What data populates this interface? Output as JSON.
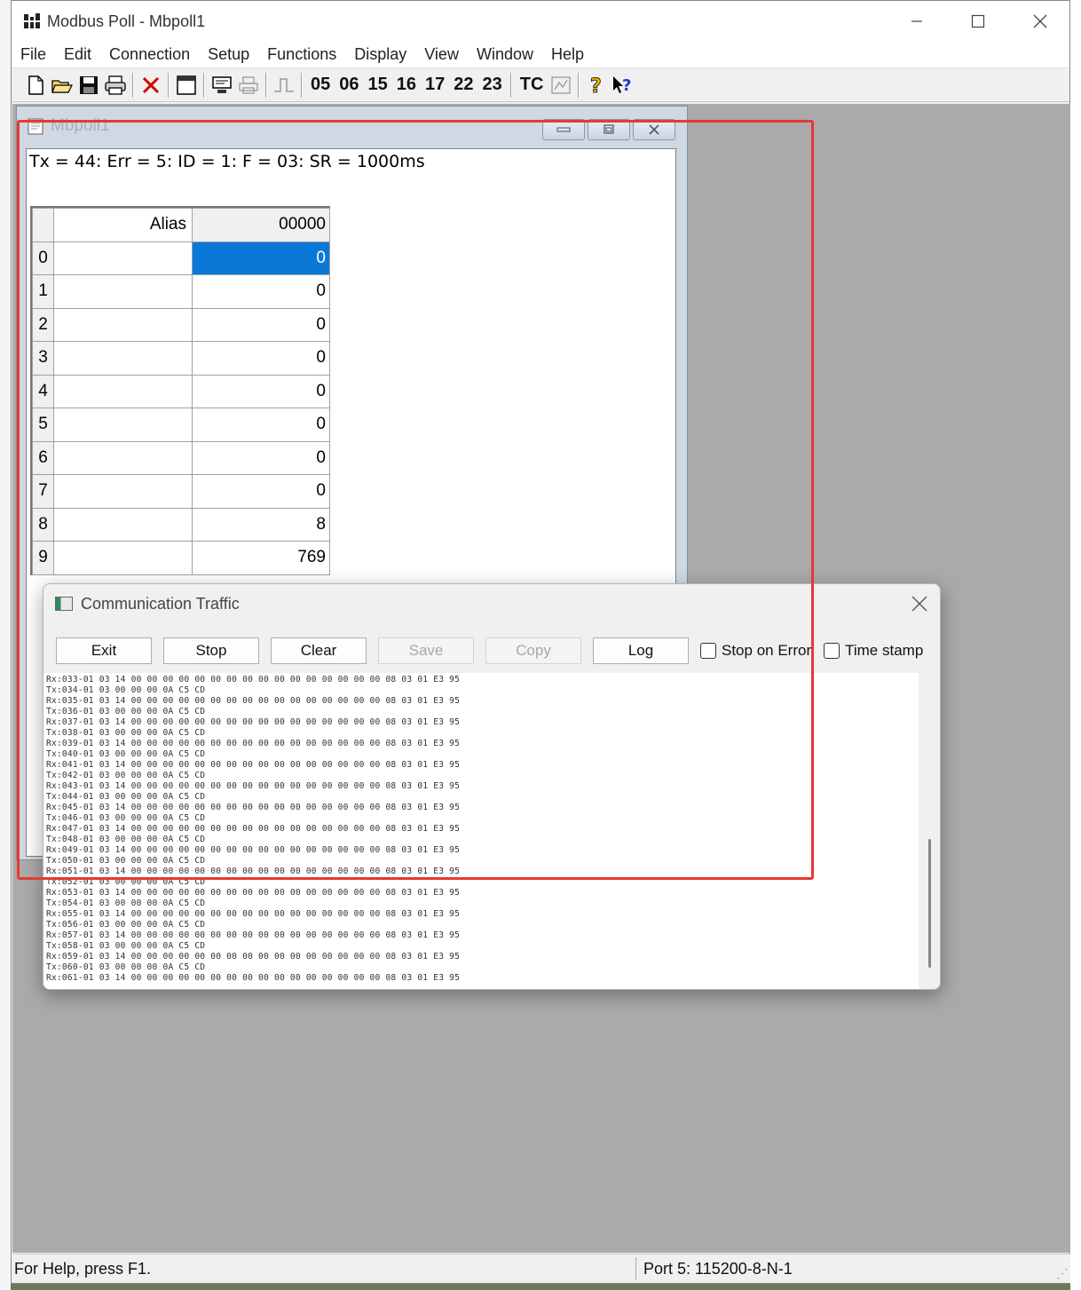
{
  "window": {
    "title": "Modbus Poll - Mbpoll1"
  },
  "menu": [
    "File",
    "Edit",
    "Connection",
    "Setup",
    "Functions",
    "Display",
    "View",
    "Window",
    "Help"
  ],
  "toolbar": {
    "function_codes": [
      "05",
      "06",
      "15",
      "16",
      "17",
      "22",
      "23"
    ],
    "tc_label": "TC"
  },
  "child": {
    "title": "Mbpoll1",
    "status": "Tx = 44: Err = 5: ID = 1: F = 03: SR = 1000ms",
    "columns": {
      "alias": "Alias",
      "address": "00000"
    },
    "rows": [
      {
        "index": "0",
        "alias": "",
        "value": "0"
      },
      {
        "index": "1",
        "alias": "",
        "value": "0"
      },
      {
        "index": "2",
        "alias": "",
        "value": "0"
      },
      {
        "index": "3",
        "alias": "",
        "value": "0"
      },
      {
        "index": "4",
        "alias": "",
        "value": "0"
      },
      {
        "index": "5",
        "alias": "",
        "value": "0"
      },
      {
        "index": "6",
        "alias": "",
        "value": "0"
      },
      {
        "index": "7",
        "alias": "",
        "value": "0"
      },
      {
        "index": "8",
        "alias": "",
        "value": "8"
      },
      {
        "index": "9",
        "alias": "",
        "value": "769"
      }
    ]
  },
  "traffic": {
    "title": "Communication Traffic",
    "buttons": {
      "exit": "Exit",
      "stop": "Stop",
      "clear": "Clear",
      "save": "Save",
      "copy": "Copy",
      "log": "Log"
    },
    "checkboxes": {
      "stop_on_error": "Stop on Error",
      "time_stamp": "Time stamp"
    },
    "lines": [
      "Rx:033-01 03 14 00 00 00 00 00 00 00 00 00 00 00 00 00 00 00 00 08 03 01 E3 95",
      "Tx:034-01 03 00 00 00 0A C5 CD",
      "Rx:035-01 03 14 00 00 00 00 00 00 00 00 00 00 00 00 00 00 00 00 08 03 01 E3 95",
      "Tx:036-01 03 00 00 00 0A C5 CD",
      "Rx:037-01 03 14 00 00 00 00 00 00 00 00 00 00 00 00 00 00 00 00 08 03 01 E3 95",
      "Tx:038-01 03 00 00 00 0A C5 CD",
      "Rx:039-01 03 14 00 00 00 00 00 00 00 00 00 00 00 00 00 00 00 00 08 03 01 E3 95",
      "Tx:040-01 03 00 00 00 0A C5 CD",
      "Rx:041-01 03 14 00 00 00 00 00 00 00 00 00 00 00 00 00 00 00 00 08 03 01 E3 95",
      "Tx:042-01 03 00 00 00 0A C5 CD",
      "Rx:043-01 03 14 00 00 00 00 00 00 00 00 00 00 00 00 00 00 00 00 08 03 01 E3 95",
      "Tx:044-01 03 00 00 00 0A C5 CD",
      "Rx:045-01 03 14 00 00 00 00 00 00 00 00 00 00 00 00 00 00 00 00 08 03 01 E3 95",
      "Tx:046-01 03 00 00 00 0A C5 CD",
      "Rx:047-01 03 14 00 00 00 00 00 00 00 00 00 00 00 00 00 00 00 00 08 03 01 E3 95",
      "Tx:048-01 03 00 00 00 0A C5 CD",
      "Rx:049-01 03 14 00 00 00 00 00 00 00 00 00 00 00 00 00 00 00 00 08 03 01 E3 95",
      "Tx:050-01 03 00 00 00 0A C5 CD",
      "Rx:051-01 03 14 00 00 00 00 00 00 00 00 00 00 00 00 00 00 00 00 08 03 01 E3 95",
      "Tx:052-01 03 00 00 00 0A C5 CD",
      "Rx:053-01 03 14 00 00 00 00 00 00 00 00 00 00 00 00 00 00 00 00 08 03 01 E3 95",
      "Tx:054-01 03 00 00 00 0A C5 CD",
      "Rx:055-01 03 14 00 00 00 00 00 00 00 00 00 00 00 00 00 00 00 00 08 03 01 E3 95",
      "Tx:056-01 03 00 00 00 0A C5 CD",
      "Rx:057-01 03 14 00 00 00 00 00 00 00 00 00 00 00 00 00 00 00 00 08 03 01 E3 95",
      "Tx:058-01 03 00 00 00 0A C5 CD",
      "Rx:059-01 03 14 00 00 00 00 00 00 00 00 00 00 00 00 00 00 00 00 08 03 01 E3 95",
      "Tx:060-01 03 00 00 00 0A C5 CD",
      "Rx:061-01 03 14 00 00 00 00 00 00 00 00 00 00 00 00 00 00 00 00 08 03 01 E3 95"
    ]
  },
  "statusbar": {
    "help": "For Help, press F1.",
    "port": "Port 5: 115200-8-N-1"
  },
  "colors": {
    "selection": "#0a78d7",
    "highlight": "#e53935",
    "mdi_background": "#aaaaaa"
  }
}
